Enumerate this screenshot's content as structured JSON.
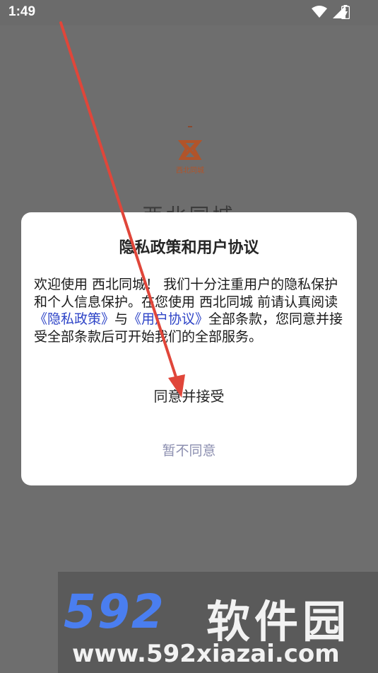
{
  "status_bar": {
    "time": "1:49"
  },
  "splash": {
    "logo_text": "西北同城",
    "app_name": "西北同城"
  },
  "dialog": {
    "title": "隐私政策和用户协议",
    "body_part1": "欢迎使用 西北同城！ 我们十分注重用户的隐私保护和个人信息保护。在您使用 西北同城 前请认真阅读 ",
    "privacy_link": "《隐私政策》",
    "body_and": "与",
    "terms_link": "《用户协议》",
    "body_part2": "全部条款，您同意并接受全部条款后可开始我们的全部服务。",
    "accept_label": "同意并接受",
    "decline_label": "暂不同意"
  },
  "watermark": {
    "brand_number": "592",
    "brand_cn": "软件园",
    "url": "www.592xiazai.com"
  },
  "colors": {
    "overlay": "#6e6e6e",
    "link": "#2e44c7",
    "decline": "#8c8fb0",
    "logo": "#b1542a",
    "annotation_arrow": "#e0463a"
  }
}
